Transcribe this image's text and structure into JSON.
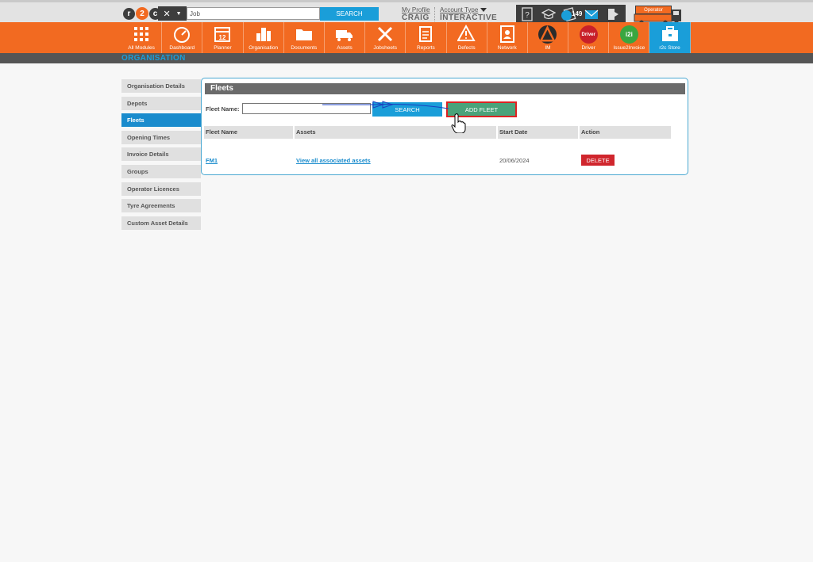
{
  "topbar": {
    "logo_letters": [
      "r",
      "2",
      "c"
    ],
    "job_input_value": "Job",
    "search_label": "SEARCH",
    "my_profile_link": "My Profile",
    "user_name": "CRAIG",
    "account_type_link": "Account Type",
    "account_type_value": "INTERACTIVE",
    "notification_count": "149",
    "operator_label": "Operator"
  },
  "nav": {
    "items": [
      {
        "label": "All Modules",
        "icon": "grid-icon"
      },
      {
        "label": "Dashboard",
        "icon": "speedometer-icon"
      },
      {
        "label": "Planner",
        "icon": "calendar-icon",
        "day": "12"
      },
      {
        "label": "Organisation",
        "icon": "buildings-icon"
      },
      {
        "label": "Documents",
        "icon": "folder-icon"
      },
      {
        "label": "Assets",
        "icon": "truck-icon"
      },
      {
        "label": "Jobsheets",
        "icon": "tools-icon"
      },
      {
        "label": "Reports",
        "icon": "clipboard-icon"
      },
      {
        "label": "Defects",
        "icon": "warning-wrench-icon"
      },
      {
        "label": "Network",
        "icon": "contacts-icon"
      },
      {
        "label": "IM",
        "icon": "im-icon"
      },
      {
        "label": "Driver",
        "icon": "driver-icon",
        "badge": "Driver"
      },
      {
        "label": "Issue2Invoice",
        "icon": "i2i-icon",
        "badge": "i2i"
      },
      {
        "label": "r2c Store",
        "icon": "briefcase-icon"
      }
    ]
  },
  "page": {
    "section_title": "ORGANISATION"
  },
  "sidebar": {
    "items": [
      {
        "label": "Organisation Details"
      },
      {
        "label": "Depots"
      },
      {
        "label": "Fleets"
      },
      {
        "label": "Opening Times"
      },
      {
        "label": "Invoice Details"
      },
      {
        "label": "Groups"
      },
      {
        "label": "Operator Licences"
      },
      {
        "label": "Tyre Agreements"
      },
      {
        "label": "Custom Asset Details"
      }
    ]
  },
  "fleets": {
    "title": "Fleets",
    "fleet_name_label": "Fleet Name:",
    "fleet_name_value": "",
    "search_label": "SEARCH",
    "add_fleet_label": "ADD FLEET",
    "columns": [
      "Fleet Name",
      "Assets",
      "Start Date",
      "Action"
    ],
    "rows": [
      {
        "fleet_name": "FM1",
        "assets": "View all associated assets",
        "start_date": "20/06/2024",
        "action": "DELETE"
      }
    ]
  },
  "colors": {
    "orange": "#f26a21",
    "blue": "#1a9ed9",
    "green": "#4aa37a",
    "red": "#d0262d",
    "dark": "#3d3d3d"
  }
}
